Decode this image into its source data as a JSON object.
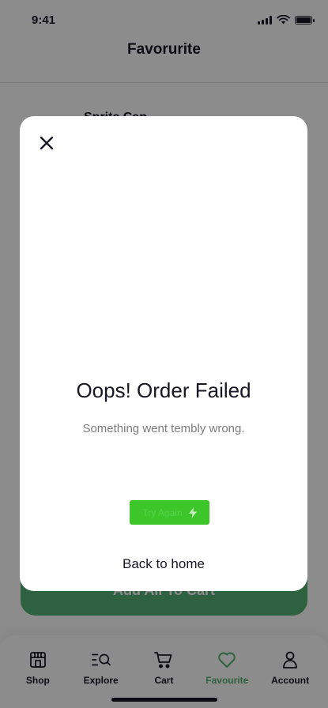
{
  "status_bar": {
    "time": "9:41"
  },
  "header": {
    "title": "Favorurite"
  },
  "list": {
    "first_item_name": "Sprite Can"
  },
  "footer_button": {
    "label": "Add All To Cart"
  },
  "nav": {
    "items": [
      {
        "label": "Shop",
        "icon": "store-icon"
      },
      {
        "label": "Explore",
        "icon": "explore-icon"
      },
      {
        "label": "Cart",
        "icon": "cart-icon"
      },
      {
        "label": "Favourite",
        "icon": "heart-icon",
        "active": true
      },
      {
        "label": "Account",
        "icon": "account-icon"
      }
    ]
  },
  "modal": {
    "title": "Oops! Order Failed",
    "subtitle": "Something went tembly wrong.",
    "retry_label": "Try Again",
    "back_label": "Back to home"
  },
  "colors": {
    "accent": "#53b175",
    "retry_button": "#3cc62a",
    "text": "#181725",
    "muted": "#7c7c7c"
  }
}
